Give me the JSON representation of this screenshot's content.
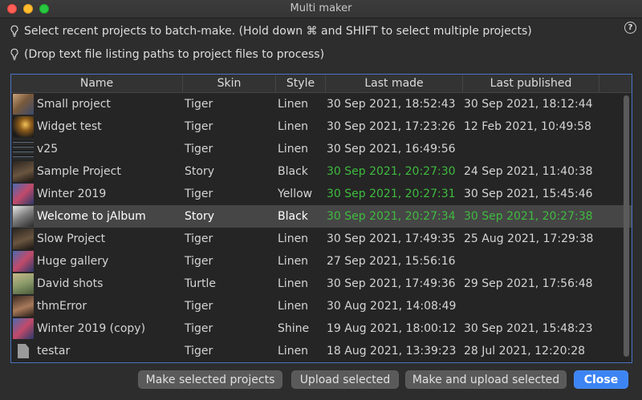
{
  "window": {
    "title": "Multi maker"
  },
  "hints": {
    "line1": "Select recent projects to batch-make. (Hold down ⌘ and SHIFT to select multiple projects)",
    "line2": "(Drop text file listing paths to project files to process)",
    "help_glyph": "?"
  },
  "table": {
    "headers": {
      "name": "Name",
      "skin": "Skin",
      "style": "Style",
      "last_made": "Last made",
      "last_published": "Last published"
    },
    "rows": [
      {
        "name": "Small project",
        "skin": "Tiger",
        "style": "Linen",
        "last_made": "30 Sep 2021, 18:52:43",
        "last_published": "30 Sep 2021, 18:12:44",
        "thumb": "photo-collage"
      },
      {
        "name": "Widget test",
        "skin": "Tiger",
        "style": "Linen",
        "last_made": "30 Sep 2021, 17:23:26",
        "last_published": "12 Feb 2021, 10:49:58",
        "thumb": "night-scene"
      },
      {
        "name": "v25",
        "skin": "Tiger",
        "style": "Linen",
        "last_made": "30 Sep 2021, 16:49:56",
        "last_published": "",
        "thumb": "screenshot"
      },
      {
        "name": "Sample Project",
        "skin": "Story",
        "style": "Black",
        "last_made": "30 Sep 2021, 20:27:30",
        "last_published": "24 Sep 2021, 11:40:38",
        "thumb": "portrait",
        "made_highlight": true
      },
      {
        "name": "Winter 2019",
        "skin": "Tiger",
        "style": "Yellow",
        "last_made": "30 Sep 2021, 20:27:31",
        "last_published": "30 Sep 2021, 15:45:46",
        "thumb": "people",
        "made_highlight": true
      },
      {
        "name": "Welcome to jAlbum",
        "skin": "Story",
        "style": "Black",
        "last_made": "30 Sep 2021, 20:27:34",
        "last_published": "30 Sep 2021, 20:27:38",
        "thumb": "bw-photo",
        "made_highlight": true,
        "published_highlight": true,
        "selected": true
      },
      {
        "name": "Slow Project",
        "skin": "Tiger",
        "style": "Linen",
        "last_made": "30 Sep 2021, 17:49:35",
        "last_published": "25 Aug 2021, 17:29:38",
        "thumb": "portrait"
      },
      {
        "name": "Huge gallery",
        "skin": "Tiger",
        "style": "Linen",
        "last_made": "27 Sep 2021, 15:56:16",
        "last_published": "",
        "thumb": "people"
      },
      {
        "name": "David shots",
        "skin": "Turtle",
        "style": "Linen",
        "last_made": "30 Sep 2021, 17:49:36",
        "last_published": "29 Sep 2021, 17:56:48",
        "thumb": "outdoor"
      },
      {
        "name": "thmError",
        "skin": "Tiger",
        "style": "Linen",
        "last_made": "30 Aug 2021, 14:08:49",
        "last_published": "",
        "thumb": "person"
      },
      {
        "name": "Winter 2019 (copy)",
        "skin": "Tiger",
        "style": "Shine",
        "last_made": "19 Aug 2021, 18:00:12",
        "last_published": "30 Sep 2021, 15:48:23",
        "thumb": "people"
      },
      {
        "name": "testar",
        "skin": "Tiger",
        "style": "Linen",
        "last_made": "18 Aug 2021, 13:39:23",
        "last_published": "28 Jul 2021, 12:20:28",
        "thumb": "document"
      }
    ]
  },
  "buttons": {
    "make_selected": "Make selected projects",
    "upload_selected": "Upload selected",
    "make_and_upload": "Make and upload selected",
    "close": "Close"
  },
  "colors": {
    "accent": "#3d84f4",
    "highlight_green": "#3fbb3f",
    "selection": "#464646"
  }
}
